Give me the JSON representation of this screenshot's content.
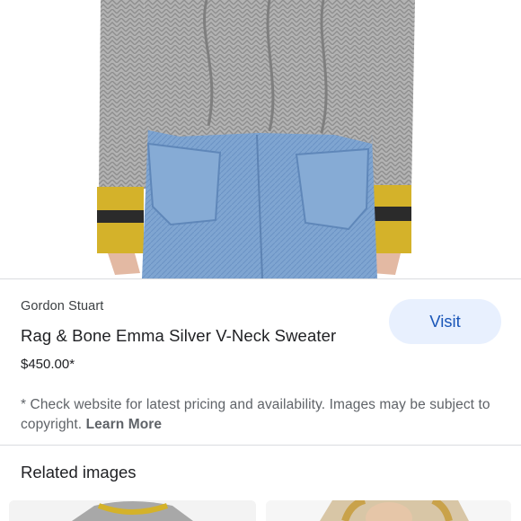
{
  "product": {
    "image_alt": "Rag & Bone Emma Silver V-Neck Sweater product photo",
    "source": "Gordon Stuart",
    "title": "Rag & Bone Emma Silver V-Neck Sweater",
    "price": "$450.00*",
    "visit_label": "Visit"
  },
  "disclaimer": {
    "text": "* Check website for latest pricing and availability. Images may be subject to copyright. ",
    "link_label": "Learn More"
  },
  "related": {
    "title": "Related images"
  },
  "colors": {
    "accent": "#1a56b8",
    "button_bg": "#e8f0fe",
    "divider": "#dadce0",
    "sweater": "#a9a9a9",
    "cuff_yellow": "#d4b22a",
    "denim": "#7ea3cf"
  }
}
